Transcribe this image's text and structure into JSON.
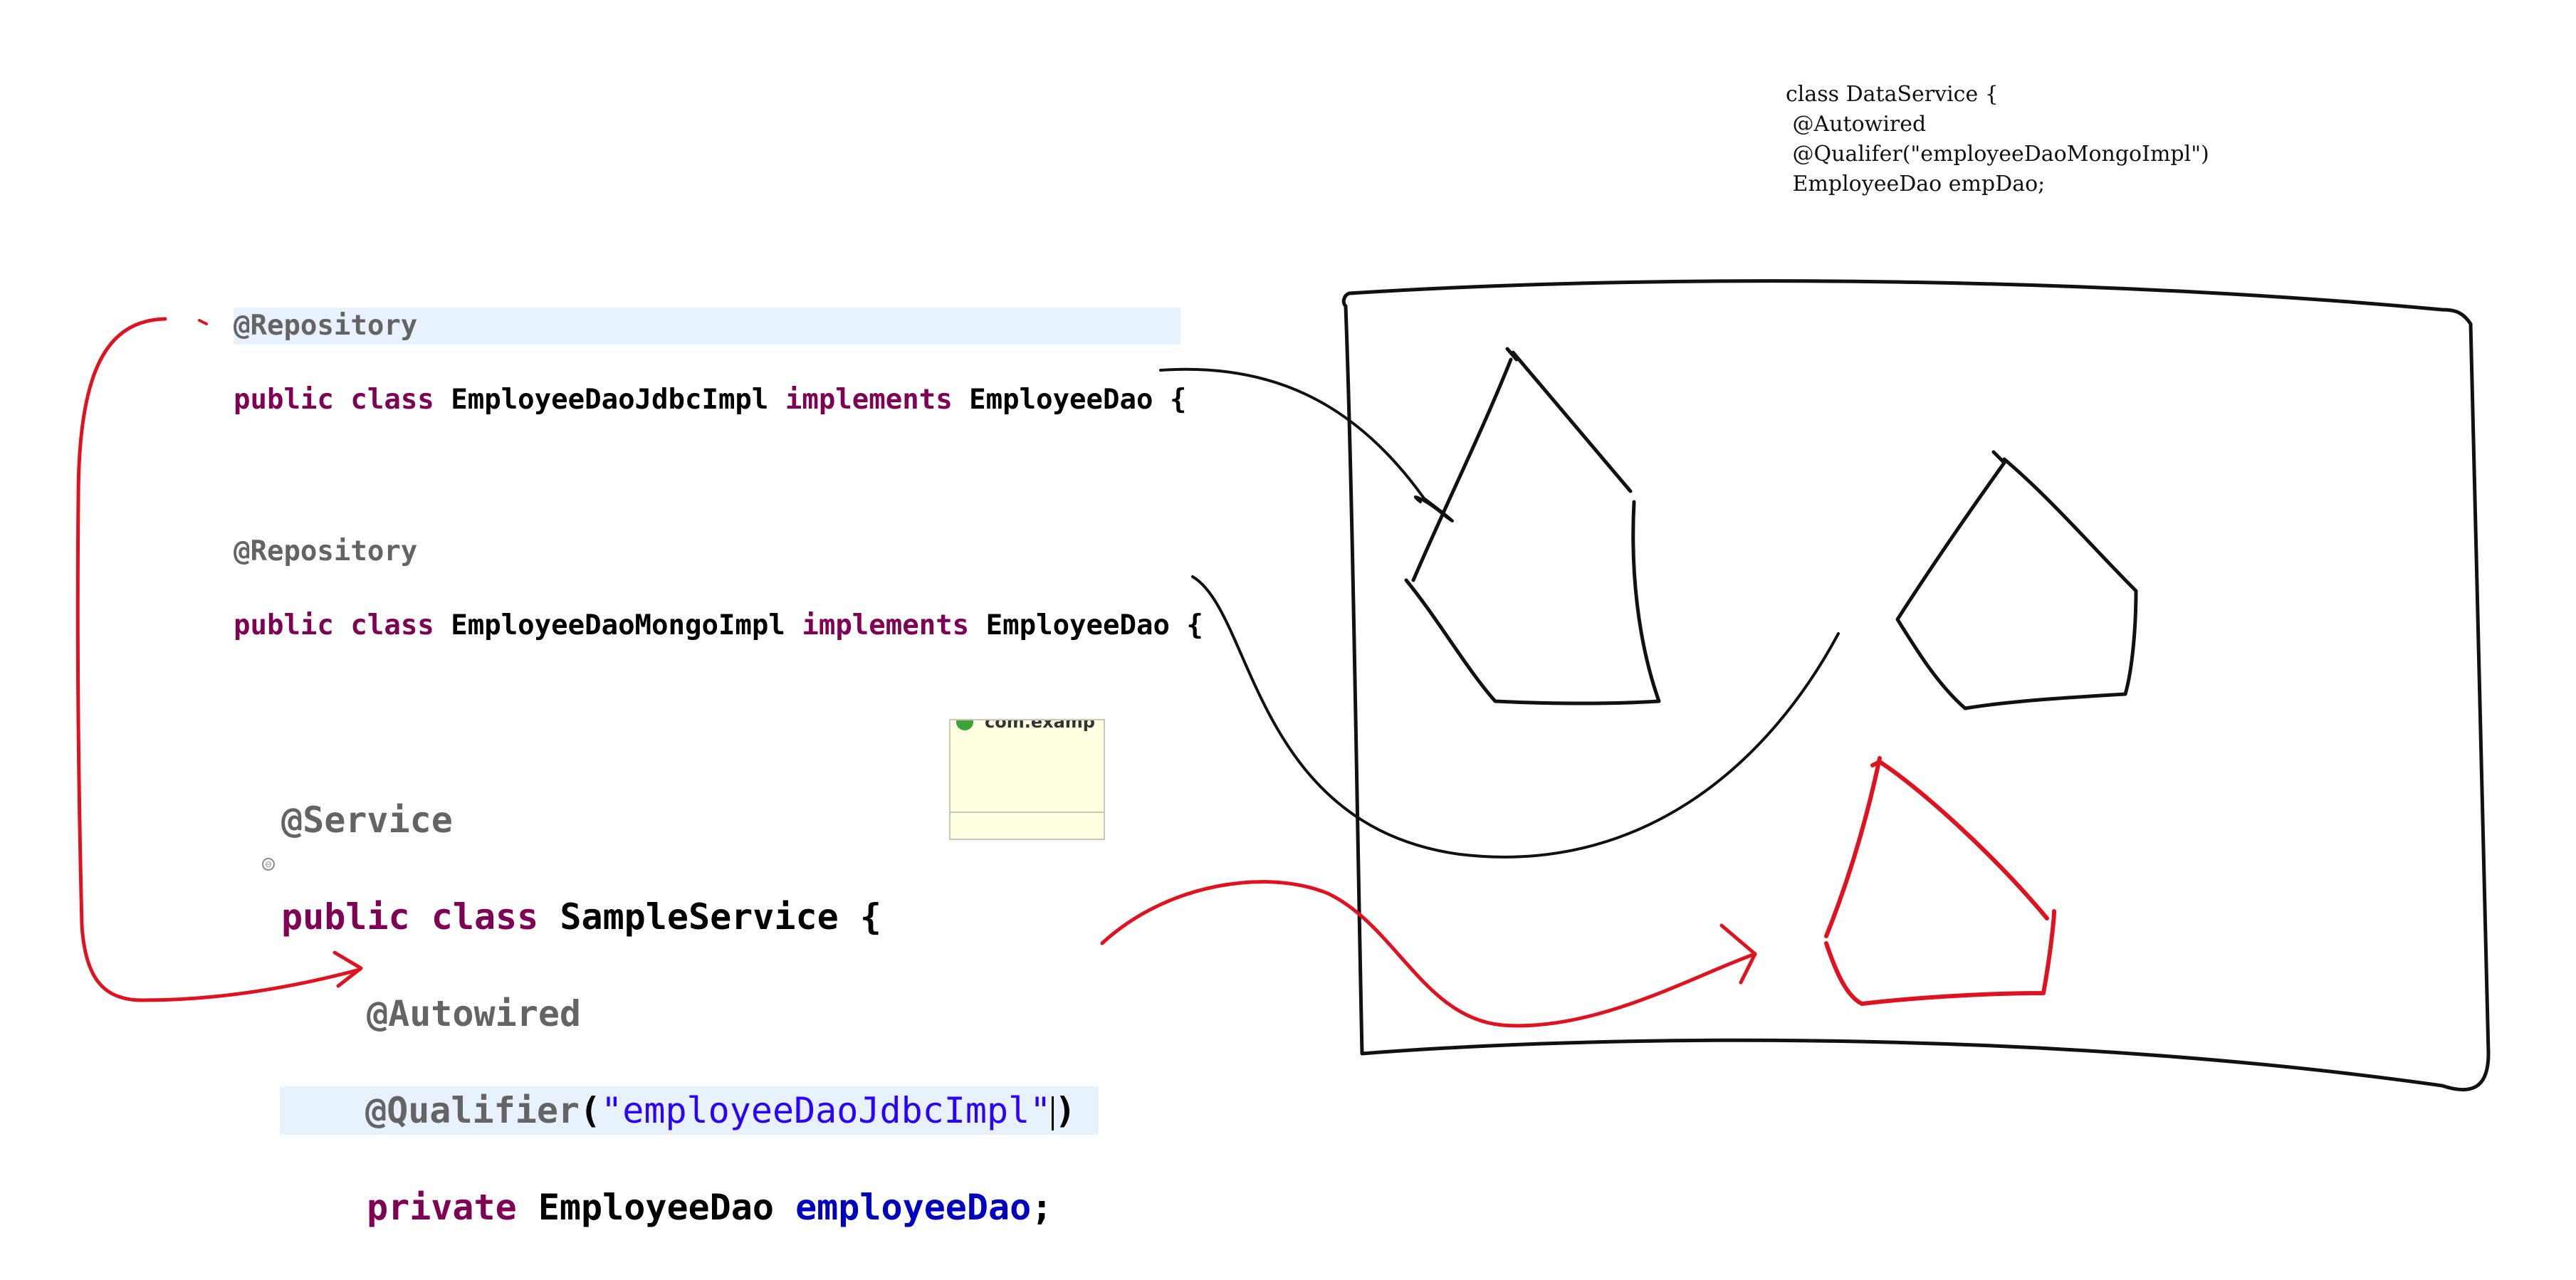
{
  "repository_jdbc": {
    "annotation": "@Repository",
    "kw_public": "public",
    "kw_class": "class",
    "class_name": "EmployeeDaoJdbcImpl",
    "kw_implements": "implements",
    "interface_name": "EmployeeDao",
    "brace": "{"
  },
  "repository_mongo": {
    "annotation": "@Repository",
    "kw_public": "public",
    "kw_class": "class",
    "class_name": "EmployeeDaoMongoImpl",
    "kw_implements": "implements",
    "interface_name": "EmployeeDao",
    "brace": "{"
  },
  "service": {
    "annotation": "@Service",
    "kw_public": "public",
    "kw_class": "class",
    "class_name": "SampleService",
    "brace": "{",
    "autowired": "@Autowired",
    "qualifier_annotation": "@Qualifier",
    "qualifier_open": "(",
    "qualifier_value": "\"employeeDaoJdbcImpl\"",
    "qualifier_close": ")",
    "kw_private": "private",
    "field_type": "EmployeeDao",
    "field_name": "employeeDao",
    "semicolon": ";",
    "fold_glyph": "⊖"
  },
  "popup": {
    "text": "com.examp"
  },
  "handwritten_note": {
    "line1": "class DataService {",
    "line2": " @Autowired",
    "line3": " @Qualifer(\"employeeDaoMongoImpl\")",
    "line4": " EmployeeDao empDao;"
  },
  "colors": {
    "keyword": "#7f0055",
    "annotation": "#646464",
    "string": "#2a00ff",
    "field": "#0000c0",
    "highlight": "#e8f2fe",
    "ink_black": "#111111",
    "ink_red": "#e0121f"
  }
}
